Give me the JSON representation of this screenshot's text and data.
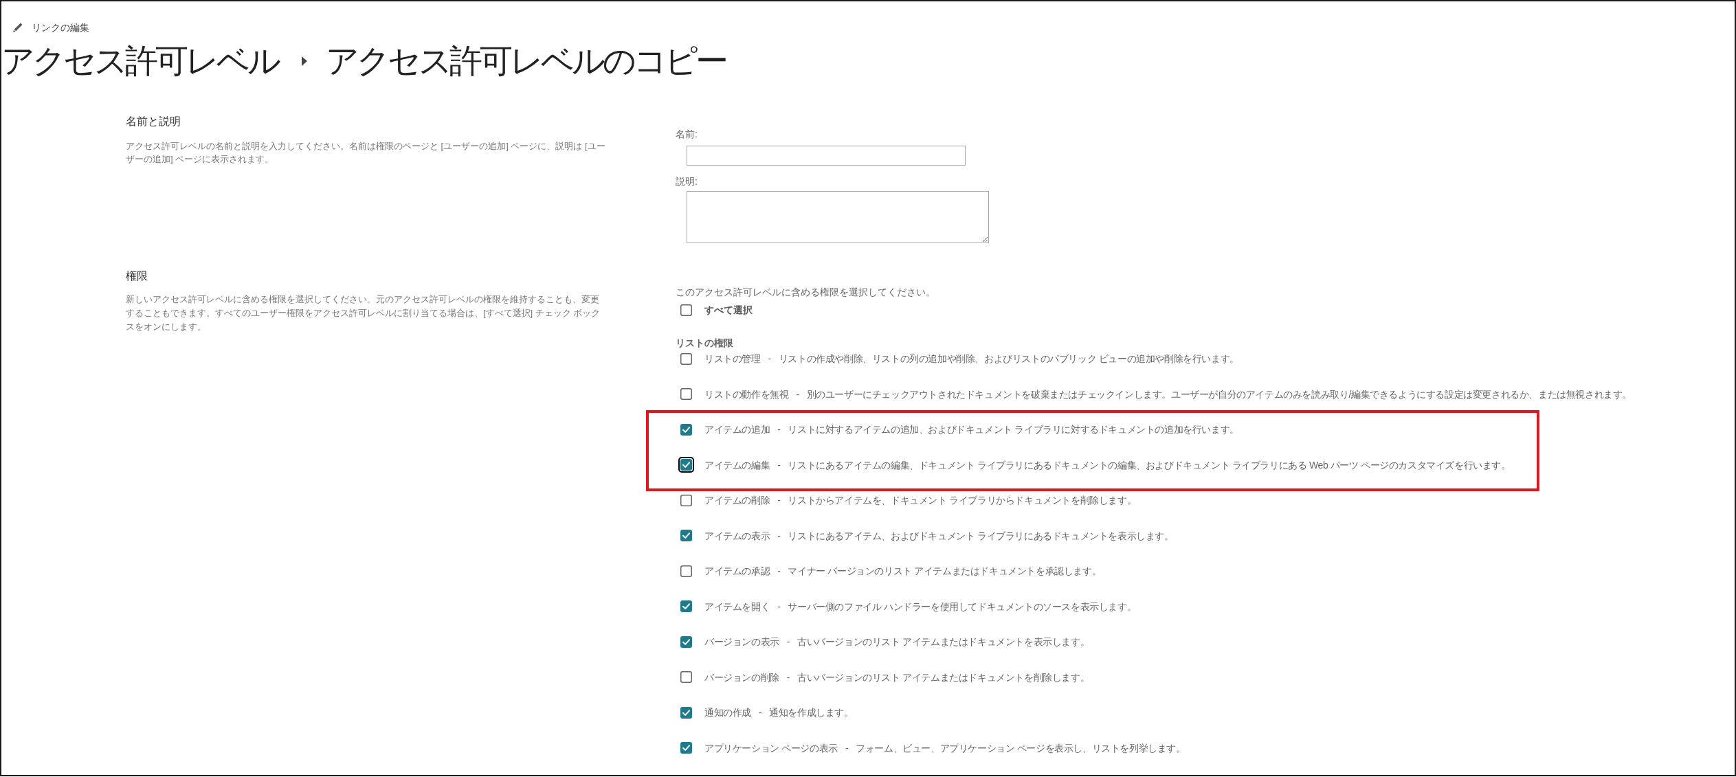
{
  "edit_links": {
    "label": "リンクの編集"
  },
  "breadcrumb": {
    "parent": "アクセス許可レベル",
    "current": "アクセス許可レベルのコピー"
  },
  "name_section": {
    "heading": "名前と説明",
    "description": "アクセス許可レベルの名前と説明を入力してください。名前は権限のページと [ユーザーの追加] ページに、説明は [ユーザーの追加] ページに表示されます。",
    "fields": [
      {
        "kind": "text",
        "label": "名前:"
      },
      {
        "kind": "textarea",
        "label": "説明:"
      }
    ]
  },
  "permissions_section": {
    "heading": "権限",
    "description": "新しいアクセス許可レベルに含める権限を選択してください。元のアクセス許可レベルの権限を維持することも、変更することもできます。すべてのユーザー権限をアクセス許可レベルに割り当てる場合は、[すべて選択] チェック ボックスをオンにします。",
    "instruction": "このアクセス許可レベルに含める権限を選択してください。",
    "select_all": {
      "label": "すべて選択",
      "checked": false
    },
    "groups": [
      {
        "title": "リストの権限",
        "separator": "-",
        "items": [
          {
            "name": "リストの管理",
            "description": "リストの作成や削除、リストの列の追加や削除、およびリストのパブリック ビューの追加や削除を行います。",
            "checked": false,
            "focused": false,
            "highlighted": false
          },
          {
            "name": "リストの動作を無視",
            "description": "別のユーザーにチェックアウトされたドキュメントを破棄またはチェックインします。ユーザーが自分のアイテムのみを読み取り/編集できるようにする設定は変更されるか、または無視されます。",
            "checked": false,
            "focused": false,
            "highlighted": false
          },
          {
            "name": "アイテムの追加",
            "description": "リストに対するアイテムの追加、およびドキュメント ライブラリに対するドキュメントの追加を行います。",
            "checked": true,
            "focused": false,
            "highlighted": true
          },
          {
            "name": "アイテムの編集",
            "description": "リストにあるアイテムの編集、ドキュメント ライブラリにあるドキュメントの編集、およびドキュメント ライブラリにある Web パーツ ページのカスタマイズを行います。",
            "checked": true,
            "focused": true,
            "highlighted": true
          },
          {
            "name": "アイテムの削除",
            "description": "リストからアイテムを、ドキュメント ライブラリからドキュメントを削除します。",
            "checked": false,
            "focused": false,
            "highlighted": false
          },
          {
            "name": "アイテムの表示",
            "description": "リストにあるアイテム、およびドキュメント ライブラリにあるドキュメントを表示します。",
            "checked": true,
            "focused": false,
            "highlighted": false
          },
          {
            "name": "アイテムの承認",
            "description": "マイナー バージョンのリスト アイテムまたはドキュメントを承認します。",
            "checked": false,
            "focused": false,
            "highlighted": false
          },
          {
            "name": "アイテムを開く",
            "description": "サーバー側のファイル ハンドラーを使用してドキュメントのソースを表示します。",
            "checked": true,
            "focused": false,
            "highlighted": false
          },
          {
            "name": "バージョンの表示",
            "description": "古いバージョンのリスト アイテムまたはドキュメントを表示します。",
            "checked": true,
            "focused": false,
            "highlighted": false
          },
          {
            "name": "バージョンの削除",
            "description": "古いバージョンのリスト アイテムまたはドキュメントを削除します。",
            "checked": false,
            "focused": false,
            "highlighted": false
          },
          {
            "name": "通知の作成",
            "description": "通知を作成します。",
            "checked": true,
            "focused": false,
            "highlighted": false
          },
          {
            "name": "アプリケーション ページの表示",
            "description": "フォーム、ビュー、アプリケーション ページを表示し、リストを列挙します。",
            "checked": true,
            "focused": false,
            "highlighted": false
          }
        ]
      }
    ]
  }
}
